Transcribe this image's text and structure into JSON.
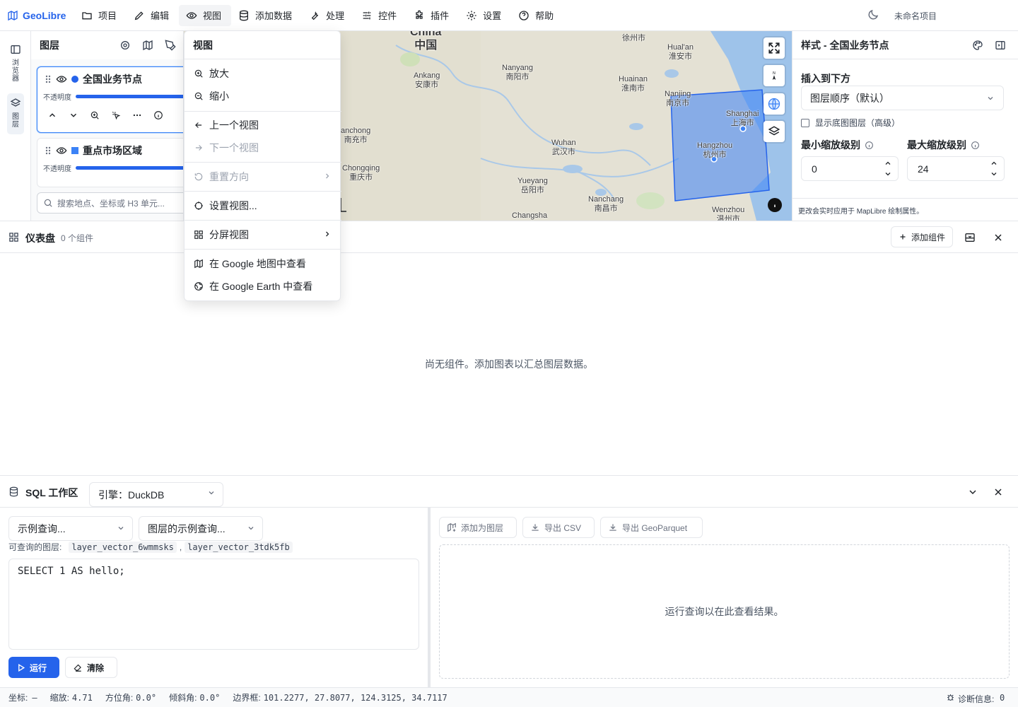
{
  "app": {
    "brand": "GeoLibre",
    "project_name": "未命名项目"
  },
  "menubar": {
    "items": [
      {
        "label": "项目",
        "icon": "folder-icon"
      },
      {
        "label": "编辑",
        "icon": "pencil-icon"
      },
      {
        "label": "视图",
        "icon": "eye-icon"
      },
      {
        "label": "添加数据",
        "icon": "database-icon"
      },
      {
        "label": "处理",
        "icon": "wrench-icon"
      },
      {
        "label": "控件",
        "icon": "sliders-icon"
      },
      {
        "label": "插件",
        "icon": "puzzle-icon"
      },
      {
        "label": "设置",
        "icon": "gear-icon"
      },
      {
        "label": "帮助",
        "icon": "help-icon"
      }
    ]
  },
  "rail": {
    "browser_label": "浏览器",
    "layers_label": "图层"
  },
  "layers_panel": {
    "title": "图层",
    "opacity_label": "不透明度",
    "layers": [
      {
        "name": "全国业务节点",
        "color": "#2563eb",
        "opacity": 0.85
      },
      {
        "name": "重点市场区域",
        "color": "#3b82f6",
        "opacity": 0.85
      }
    ],
    "search_placeholder": "搜索地点、坐标或 H3 单元..."
  },
  "view_menu": {
    "title": "视图",
    "items": [
      {
        "label": "放大",
        "icon": "zoom-in-icon",
        "disabled": false
      },
      {
        "label": "缩小",
        "icon": "zoom-out-icon",
        "disabled": false
      },
      {
        "label": "上一个视图",
        "icon": "arrow-left-icon",
        "disabled": false
      },
      {
        "label": "下一个视图",
        "icon": "arrow-right-icon",
        "disabled": true
      },
      {
        "label": "重置方向",
        "icon": "rotate-icon",
        "disabled": true
      },
      {
        "label": "设置视图...",
        "icon": "target-icon",
        "disabled": false
      },
      {
        "label": "分屏视图",
        "icon": "grid-icon",
        "disabled": false
      },
      {
        "label": "在 Google 地图中查看",
        "icon": "map-icon",
        "disabled": false
      },
      {
        "label": "在 Google Earth 中查看",
        "icon": "globe-icon",
        "disabled": false
      }
    ]
  },
  "map": {
    "labels": [
      {
        "en": "China",
        "zh": "中国"
      },
      {
        "en": "",
        "zh": "徐州市"
      },
      {
        "en": "Hual'an",
        "zh": "淮安市"
      },
      {
        "en": "Ankang",
        "zh": "安康市"
      },
      {
        "en": "Nanyang",
        "zh": "南阳市"
      },
      {
        "en": "Huainan",
        "zh": "淮南市"
      },
      {
        "en": "Nanjing",
        "zh": "南京市"
      },
      {
        "en": "Shanghai",
        "zh": "上海市"
      },
      {
        "en": "anchong",
        "zh": "南充市"
      },
      {
        "en": "Hangzhou",
        "zh": "杭州市"
      },
      {
        "en": "Wuhan",
        "zh": "武汉市"
      },
      {
        "en": "Chongqing",
        "zh": "重庆市"
      },
      {
        "en": "Yueyang",
        "zh": "岳阳市"
      },
      {
        "en": "Nanchang",
        "zh": "南昌市"
      },
      {
        "en": "Changsha",
        "zh": ""
      },
      {
        "en": "Wenzhou",
        "zh": "温州市"
      }
    ]
  },
  "style_panel": {
    "title": "样式 - 全国业务节点",
    "insert_below_label": "插入到下方",
    "insert_below_value": "图层顺序（默认）",
    "show_basemap_label": "显示底图图层（高级）",
    "min_zoom_label": "最小缩放级别",
    "min_zoom_value": "0",
    "max_zoom_label": "最大缩放级别",
    "max_zoom_value": "24",
    "footer": "更改会实时应用于 MapLibre 绘制属性。"
  },
  "dashboard": {
    "title": "仪表盘",
    "count": "0 个组件",
    "add_widget": "添加组件",
    "empty_text": "尚无组件。添加图表以汇总图层数据。"
  },
  "sql": {
    "title": "SQL 工作区",
    "engine": "引擎：DuckDB",
    "example_query": "示例查询...",
    "layer_example_query": "图层的示例查询...",
    "queryable_label": "可查询的图层:",
    "queryable_layers": [
      "layer_vector_6wmmsks",
      "layer_vector_3tdk5fb"
    ],
    "editor_text": "SELECT 1 AS hello;",
    "run": "运行",
    "clear": "清除",
    "add_as_layer": "添加为图层",
    "export_csv": "导出 CSV",
    "export_geoparquet": "导出 GeoParquet",
    "results_empty": "运行查询以在此查看结果。"
  },
  "statusbar": {
    "coord_label": "坐标:",
    "coord_value": "—",
    "zoom_label": "缩放:",
    "zoom_value": "4.71",
    "bearing_label": "方位角:",
    "bearing_value": "0.0°",
    "pitch_label": "倾斜角:",
    "pitch_value": "0.0°",
    "bounds_label": "边界框:",
    "bounds_value": "101.2277, 27.8077, 124.3125, 34.7117",
    "diag_label": "诊断信息:",
    "diag_value": "0"
  }
}
